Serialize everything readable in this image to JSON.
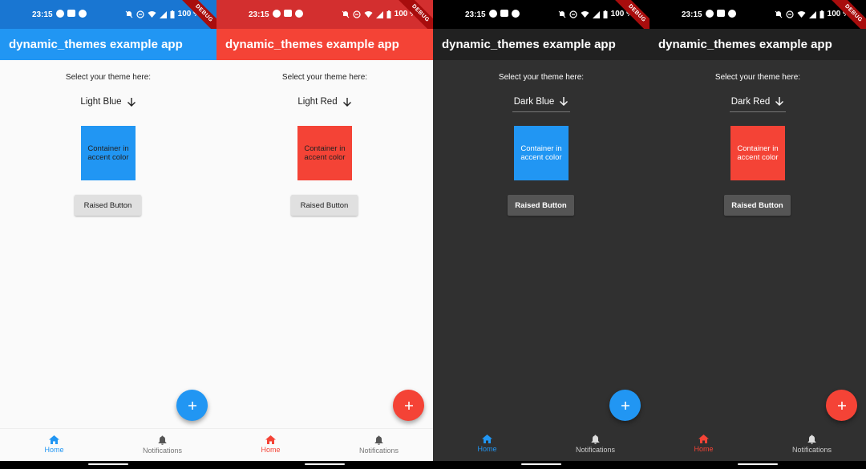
{
  "screens": [
    {
      "theme": "light",
      "status_time": "23:15",
      "battery": "100 %",
      "debug_banner": "DEBUG",
      "statusbar_color": "#1976d2",
      "appbar_color": "#2196f3",
      "accent_color": "#2196f3",
      "text_color": "#222222",
      "app_title": "dynamic_themes example app",
      "select_label": "Select your theme here:",
      "dropdown_value": "Light Blue",
      "container_text": "Container in accent color",
      "raised_button": "Raised Button",
      "fab_icon": "+",
      "nav": {
        "home": "Home",
        "notifications": "Notifications"
      }
    },
    {
      "theme": "light",
      "status_time": "23:15",
      "battery": "100 %",
      "debug_banner": "DEBUG",
      "statusbar_color": "#d32f2f",
      "appbar_color": "#f44336",
      "accent_color": "#f44336",
      "text_color": "#222222",
      "app_title": "dynamic_themes example app",
      "select_label": "Select your theme here:",
      "dropdown_value": "Light Red",
      "container_text": "Container in accent color",
      "raised_button": "Raised Button",
      "fab_icon": "+",
      "nav": {
        "home": "Home",
        "notifications": "Notifications"
      }
    },
    {
      "theme": "dark",
      "status_time": "23:15",
      "battery": "100 %",
      "debug_banner": "DEBUG",
      "statusbar_color": "#000000",
      "appbar_color": "#212121",
      "accent_color": "#2196f3",
      "text_color": "#ffffff",
      "app_title": "dynamic_themes example app",
      "select_label": "Select your theme here:",
      "dropdown_value": "Dark Blue",
      "container_text": "Container in accent color",
      "raised_button": "Raised Button",
      "fab_icon": "+",
      "nav": {
        "home": "Home",
        "notifications": "Notifications"
      }
    },
    {
      "theme": "dark",
      "status_time": "23:15",
      "battery": "100 %",
      "debug_banner": "DEBUG",
      "statusbar_color": "#000000",
      "appbar_color": "#212121",
      "accent_color": "#f44336",
      "text_color": "#ffffff",
      "app_title": "dynamic_themes example app",
      "select_label": "Select your theme here:",
      "dropdown_value": "Dark Red",
      "container_text": "Container in accent color",
      "raised_button": "Raised Button",
      "fab_icon": "+",
      "nav": {
        "home": "Home",
        "notifications": "Notifications"
      }
    }
  ]
}
